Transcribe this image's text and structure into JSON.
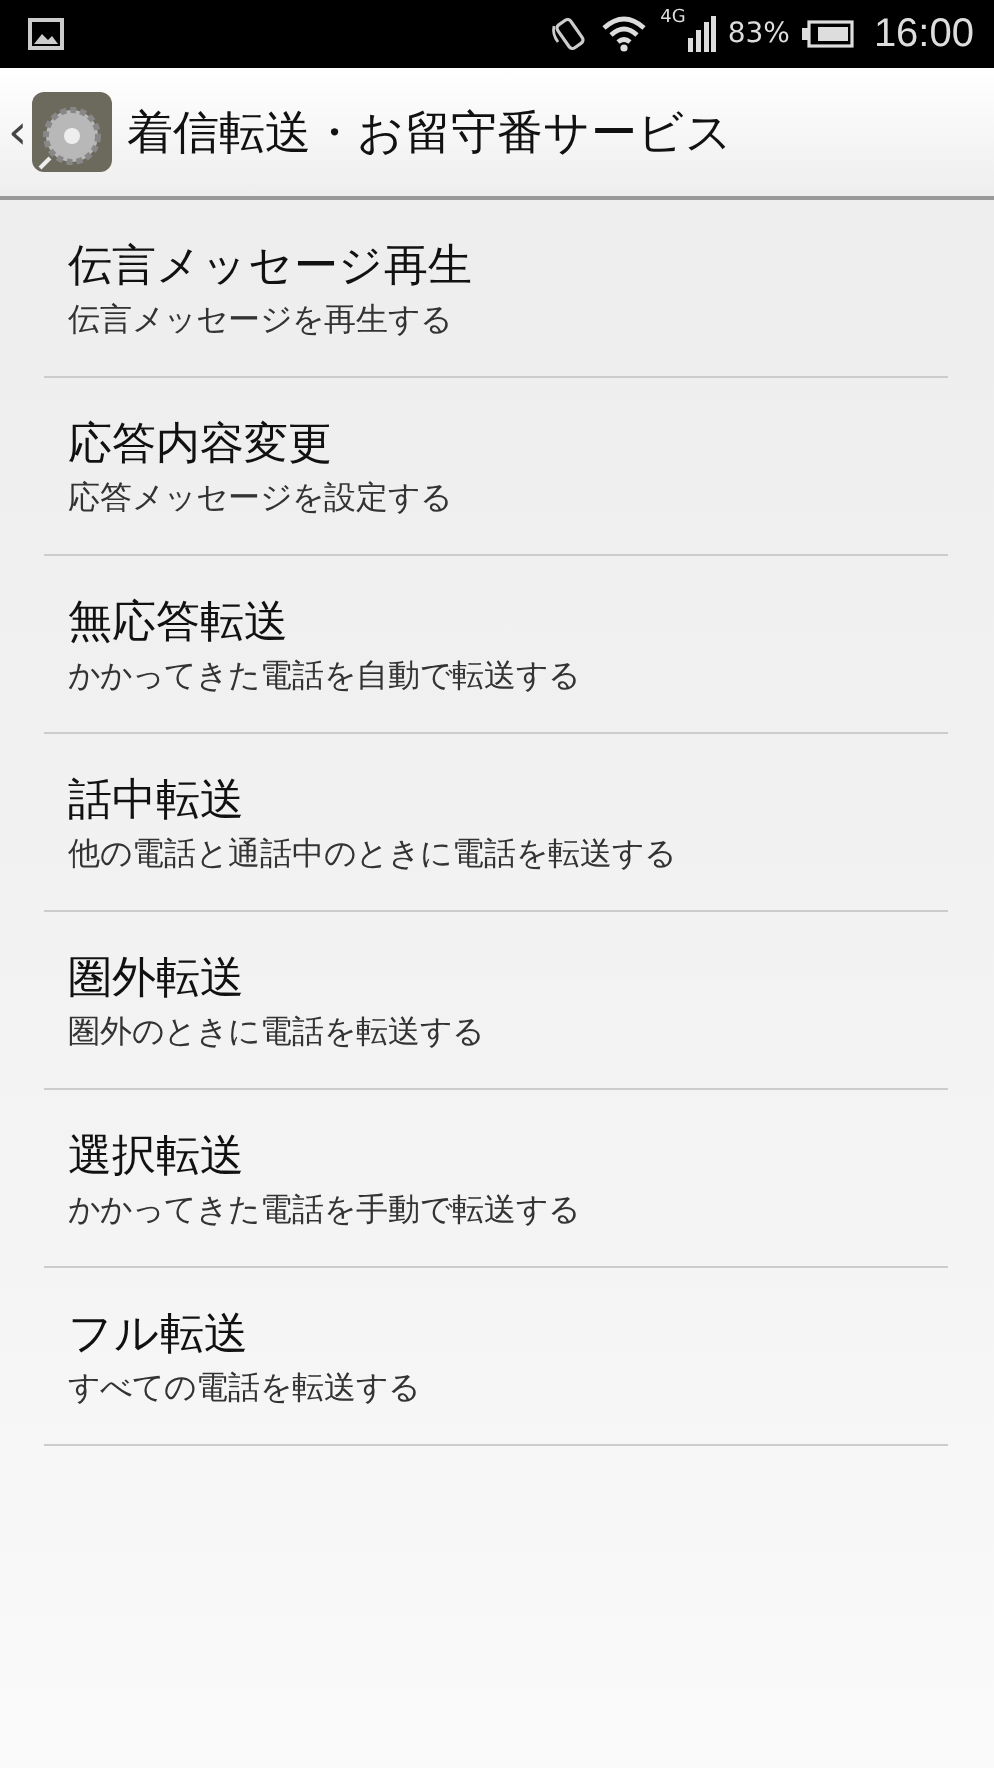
{
  "status_bar": {
    "network": "4G",
    "battery": "83%",
    "time": "16:00"
  },
  "header": {
    "back": "‹",
    "title": "着信転送・お留守番サービス"
  },
  "items": [
    {
      "title": "伝言メッセージ再生",
      "subtitle": "伝言メッセージを再生する"
    },
    {
      "title": "応答内容変更",
      "subtitle": "応答メッセージを設定する"
    },
    {
      "title": "無応答転送",
      "subtitle": "かかってきた電話を自動で転送する"
    },
    {
      "title": "話中転送",
      "subtitle": "他の電話と通話中のときに電話を転送する"
    },
    {
      "title": "圏外転送",
      "subtitle": "圏外のときに電話を転送する"
    },
    {
      "title": "選択転送",
      "subtitle": "かかってきた電話を手動で転送する"
    },
    {
      "title": "フル転送",
      "subtitle": "すべての電話を転送する"
    }
  ]
}
